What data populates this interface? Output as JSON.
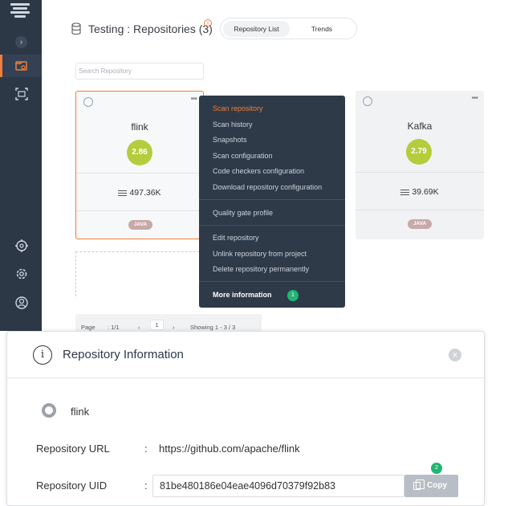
{
  "header": {
    "title": "Testing : Repositories (3)",
    "tabs": [
      "Repository List",
      "Trends"
    ]
  },
  "search": {
    "placeholder": "Search Repository"
  },
  "cards": [
    {
      "name": "flink",
      "score": "2.86",
      "size": "497.36K",
      "language": "JAVA",
      "score_color": "#b5cc3d"
    },
    {
      "name": "Kafka",
      "score": "2.79",
      "size": "39.69K",
      "language": "JAVA",
      "score_color": "#b5cc3d"
    }
  ],
  "context_menu": {
    "group1": [
      "Scan repository",
      "Scan history",
      "Snapshots",
      "Scan configuration",
      "Code checkers configuration",
      "Download repository configuration"
    ],
    "group2": [
      "Quality gate profile"
    ],
    "group3": [
      "Edit repository",
      "Unlink repository from project",
      "Delete repository permanently"
    ],
    "more": "More information",
    "more_badge": "1"
  },
  "pager": {
    "page_label": "Page",
    "page_of": "1/1",
    "page": "1",
    "showing": "Showing   1 - 3 / 3"
  },
  "modal": {
    "title": "Repository Information",
    "repo_name": "flink",
    "url_label": "Repository URL",
    "url_value": "https://github.com/apache/flink",
    "uid_label": "Repository UID",
    "uid_value": "81be480186e04eae4096d70379f92b83",
    "copy_label": "Copy",
    "copy_badge": "2",
    "colon": ":"
  },
  "colors": {
    "accent": "#f07e3a",
    "sidebar": "#2d3846",
    "badge": "#21b573",
    "menu_bg": "#2e3a48"
  },
  "icons": [
    "logo-icon",
    "expand-icon",
    "repositories-icon",
    "scan-icon",
    "settings-sliders-icon",
    "gear-icon",
    "user-icon",
    "database-icon",
    "github-icon",
    "more-icon",
    "info-icon",
    "close-icon",
    "copy-icon"
  ]
}
